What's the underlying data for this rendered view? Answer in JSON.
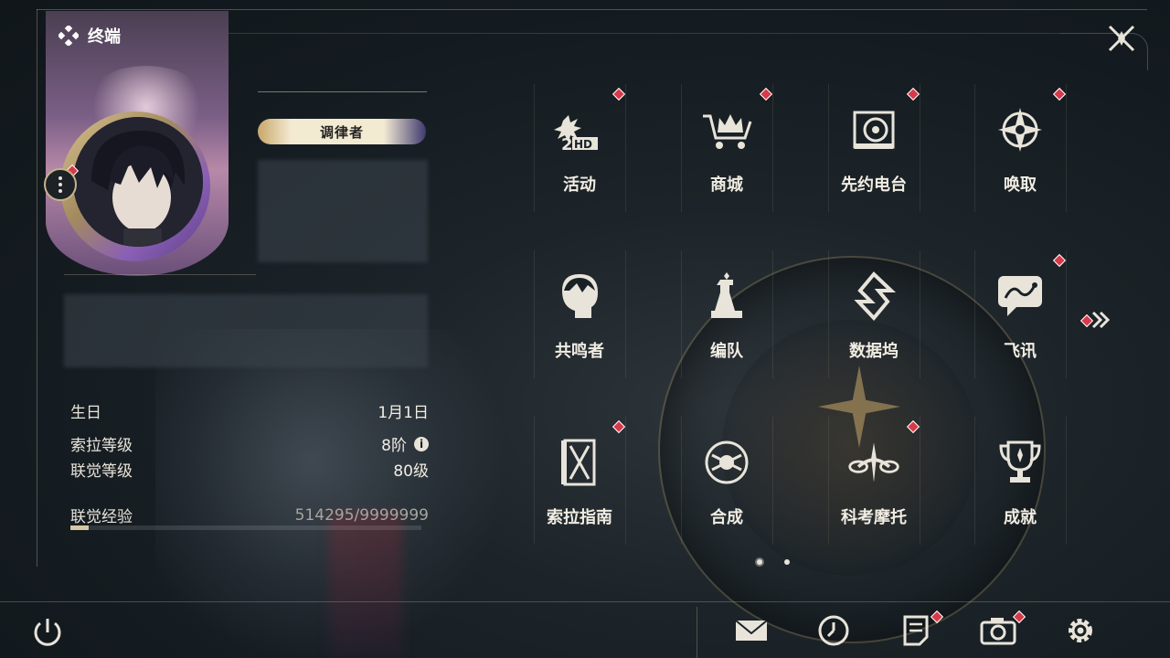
{
  "app": {
    "title": "终端"
  },
  "profile": {
    "title_badge": "调律者",
    "stats": [
      {
        "label": "生日",
        "value": "1月1日"
      },
      {
        "label": "索拉等级",
        "value": "8阶"
      },
      {
        "label": "联觉等级",
        "value": "80级"
      }
    ],
    "exp_label": "联觉经验",
    "exp_value": "514295/9999999",
    "exp_fraction": 0.0514
  },
  "menu": [
    {
      "label": "活动",
      "icon": "event-2hd-icon",
      "badge": true
    },
    {
      "label": "商城",
      "icon": "shop-crown-cart-icon",
      "badge": true
    },
    {
      "label": "先约电台",
      "icon": "radio-icon",
      "badge": true
    },
    {
      "label": "唤取",
      "icon": "convene-star-icon",
      "badge": true
    },
    {
      "label": "共鸣者",
      "icon": "resonator-head-icon",
      "badge": false
    },
    {
      "label": "编队",
      "icon": "chess-team-icon",
      "badge": false
    },
    {
      "label": "数据坞",
      "icon": "data-bank-icon",
      "badge": false
    },
    {
      "label": "飞讯",
      "icon": "chat-message-icon",
      "badge": true
    },
    {
      "label": "索拉指南",
      "icon": "guidebook-icon",
      "badge": true
    },
    {
      "label": "合成",
      "icon": "synthesis-icon",
      "badge": false
    },
    {
      "label": "科考摩托",
      "icon": "motorbike-icon",
      "badge": true
    },
    {
      "label": "成就",
      "icon": "trophy-icon",
      "badge": false
    }
  ],
  "bottom_bar": [
    {
      "icon": "mail-icon",
      "badge": false
    },
    {
      "icon": "clock-icon",
      "badge": false
    },
    {
      "icon": "notice-icon",
      "badge": true
    },
    {
      "icon": "camera-icon",
      "badge": true
    },
    {
      "icon": "settings-gear-icon",
      "badge": false
    }
  ],
  "pagination": {
    "pages": 2,
    "current": 1
  },
  "colors": {
    "accent_gold": "#c8a76a",
    "badge_red": "#d63a4a",
    "text": "#e8e4da"
  }
}
